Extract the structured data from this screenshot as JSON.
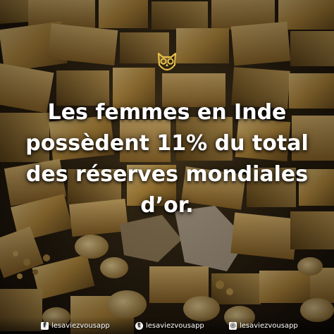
{
  "headline": {
    "lines": [
      "Les femmes en Inde",
      "possèdent 11% du total",
      "des réserves mondiales",
      "d’or."
    ]
  },
  "footer": {
    "facebook": {
      "icon": "facebook-icon",
      "handle": "lesaviezvousapp"
    },
    "twitter": {
      "icon": "twitter-icon",
      "handle": "lesaviezvousapp"
    },
    "instagram": {
      "icon": "instagram-icon",
      "handle": "lesaviezvousapp"
    }
  },
  "colors": {
    "gold": "#c9a24a",
    "gold_dark": "#7a5a22",
    "text": "#ffffff"
  }
}
